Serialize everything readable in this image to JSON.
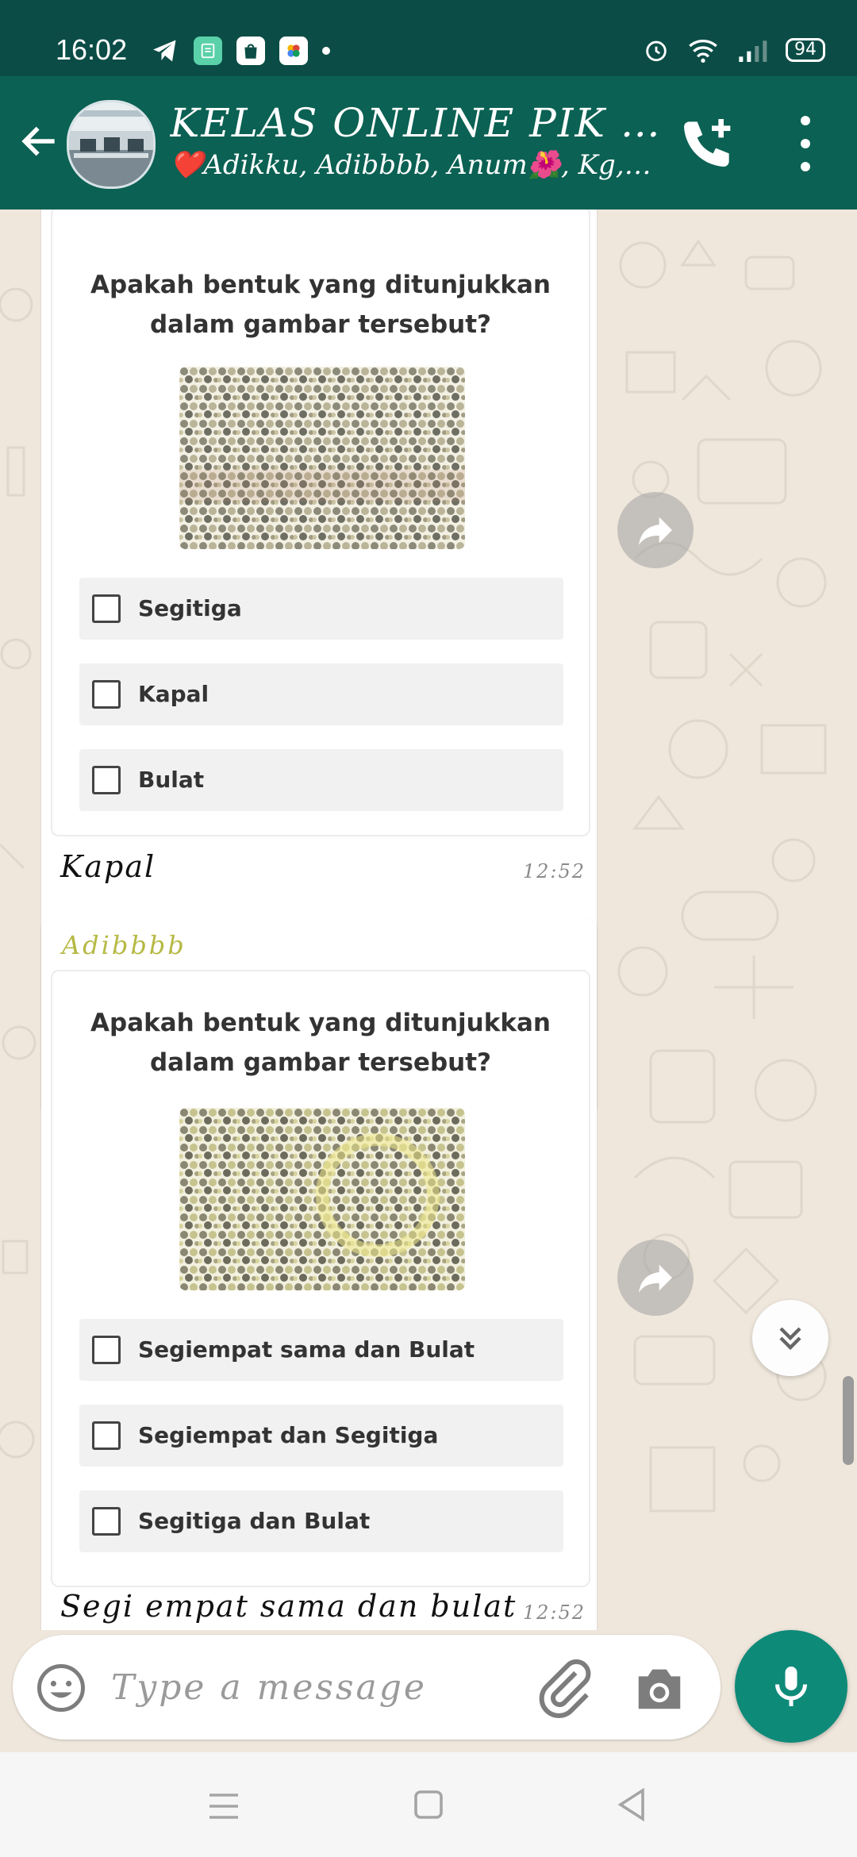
{
  "status_bar": {
    "time": "16:02",
    "battery": "94",
    "icons": [
      "telegram-icon",
      "app-icon",
      "shop-icon",
      "photos-icon",
      "alarm-icon",
      "wifi-icon",
      "signal-icon"
    ]
  },
  "header": {
    "title": "KELAS ONLINE PIK KG...",
    "subtitle": "❤️Adikku, Adibbbb, Anum🌺, Kg, ..."
  },
  "messages": [
    {
      "sender": "",
      "question": "Apakah bentuk yang ditunjukkan dalam gambar tersebut?",
      "options": [
        "Segitiga",
        "Kapal",
        "Bulat"
      ],
      "text": "Kapal",
      "time": "12:52"
    },
    {
      "sender": "Adibbbb",
      "question": "Apakah bentuk yang ditunjukkan dalam gambar tersebut?",
      "options": [
        "Segiempat sama dan Bulat",
        "Segiempat dan Segitiga",
        "Segitiga dan Bulat"
      ],
      "text": "Segi empat sama dan bulat",
      "time": "12:52"
    }
  ],
  "composer": {
    "placeholder": "Type a message"
  },
  "colors": {
    "header": "#0b6153",
    "status_bar": "#0b4d46",
    "accent": "#0e8a79",
    "sender_name": "#b6b944",
    "chat_bg": "#efe7dc"
  }
}
